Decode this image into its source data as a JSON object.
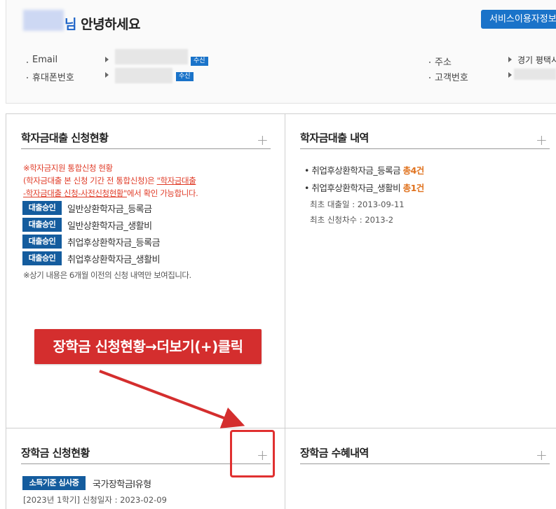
{
  "header": {
    "greeting_suffix": "님",
    "greeting_text": " 안녕하세요",
    "service_button": "서비스이용자정보",
    "email_label": "Email",
    "phone_label": "휴대폰번호",
    "address_label": "주소",
    "customer_no_label": "고객번호",
    "receive_badge": "수신",
    "address_value": "경기 평택시"
  },
  "loan_application": {
    "title": "학자금대출 신청현황",
    "notice_line1": "※학자금지원 통합신청 현황",
    "notice_line2_pre": "(학자금대출 본 신청 기간 전 통합신청)은 ",
    "notice_line2_link": "\"학자금대출",
    "notice_line3_link": "-학자금대출 신청-사전신청현황\"",
    "notice_line3_post": "에서 확인 가능합니다.",
    "items": [
      {
        "badge": "대출승인",
        "label": "일반상환학자금_등록금"
      },
      {
        "badge": "대출승인",
        "label": "일반상환학자금_생활비"
      },
      {
        "badge": "대출승인",
        "label": "취업후상환학자금_등록금"
      },
      {
        "badge": "대출승인",
        "label": "취업후상환학자금_생활비"
      }
    ],
    "footnote": "※상기 내용은 6개월 이전의 신청 내역만 보여집니다."
  },
  "loan_history": {
    "title": "학자금대출 내역",
    "items": [
      {
        "label": "취업후상환학자금_등록금 ",
        "total": "총4건"
      },
      {
        "label": "취업후상환학자금_생활비 ",
        "total": "총1건"
      }
    ],
    "first_loan_date": "최초 대출일 : 2013-09-11",
    "first_term": "최초 신청차수 : 2013-2"
  },
  "scholarship_application": {
    "title": "장학금 신청현황",
    "badge": "소득기준 심사중",
    "type": "국가장학금Ⅰ유형",
    "term": "[2023년 1학기]  신청일자 : 2023-02-09"
  },
  "scholarship_benefits": {
    "title": "장학금 수혜내역"
  },
  "plus_symbol": "+",
  "callout": {
    "text": "장학금 신청현황→더보기(+)클릭"
  },
  "colors": {
    "brand_blue": "#1a73c9",
    "badge_navy": "#145c9e",
    "notice_red": "#e03c28",
    "total_orange": "#e0721e",
    "callout_red": "#d42e2e"
  }
}
